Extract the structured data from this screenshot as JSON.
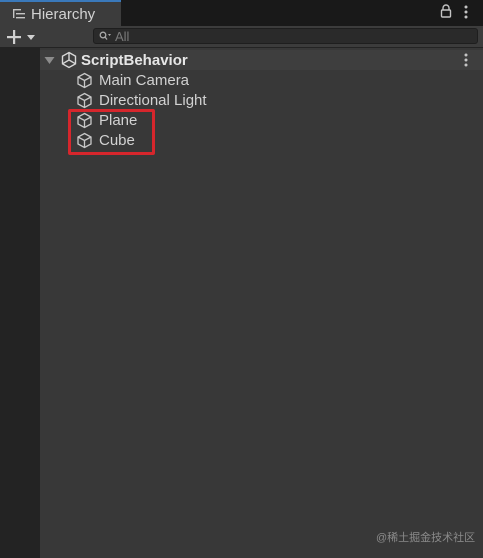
{
  "panel": {
    "tab_label": "Hierarchy",
    "tab_icon": "hierarchy-list-icon",
    "lock_icon": "lock-icon",
    "menu_icon": "kebab-menu-icon"
  },
  "toolbar": {
    "add_icon": "plus-icon",
    "dropdown_icon": "dropdown-arrow-icon",
    "search_placeholder": "All",
    "search_icon": "search-icon"
  },
  "hierarchy": {
    "scene": {
      "name": "ScriptBehavior",
      "icon": "unity-logo-icon",
      "expanded": true
    },
    "objects": [
      {
        "name": "Main Camera",
        "icon": "gameobject-cube-icon"
      },
      {
        "name": "Directional Light",
        "icon": "gameobject-cube-icon"
      },
      {
        "name": "Plane",
        "icon": "gameobject-cube-icon",
        "highlighted": true
      },
      {
        "name": "Cube",
        "icon": "gameobject-cube-icon",
        "highlighted": true
      }
    ]
  },
  "annotation": {
    "highlight_color": "#d6262c"
  },
  "watermark": {
    "text": "@稀土掘金技术社区"
  },
  "colors": {
    "panel_bg": "#383838",
    "toolbar_bg": "#3c3c3c",
    "tab_accent": "#3a79bb",
    "text": "#d2d2d2"
  }
}
